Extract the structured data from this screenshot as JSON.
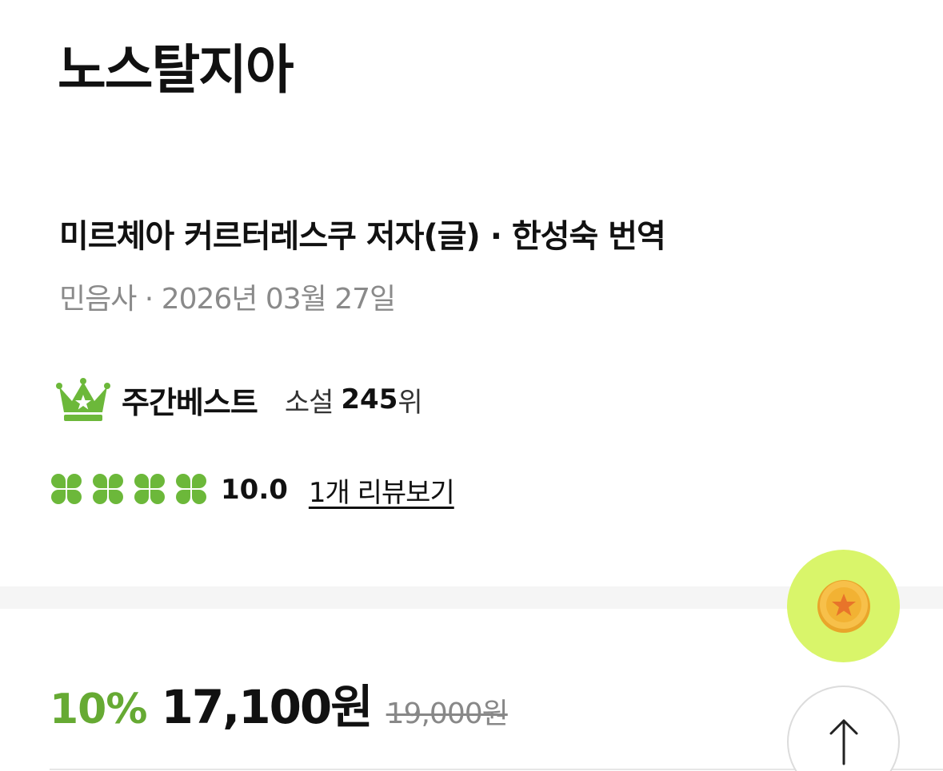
{
  "book": {
    "title": "노스탈지아",
    "authors": "미르체아 커르터레스쿠 저자(글) · 한성숙 번역",
    "publisher_date": "민음사 · 2026년 03월 27일"
  },
  "bestseller": {
    "icon": "crown-icon",
    "label": "주간베스트",
    "category": "소설",
    "rank": "245",
    "rank_unit": "위"
  },
  "rating": {
    "icon": "clover-icon",
    "clover_count": 4,
    "score": "10.0",
    "review_link": "1개 리뷰보기"
  },
  "price": {
    "discount": "10%",
    "sale_price": "17,100원",
    "original_price": "19,000원"
  },
  "fabs": {
    "coin_icon": "star-coin-icon",
    "top_icon": "arrow-up-icon"
  },
  "colors": {
    "accent_green": "#66aa33",
    "clover_green": "#6cb83a",
    "coin_fab_bg": "#d9f56a",
    "coin_gold": "#f2b233",
    "coin_star": "#e8742a"
  }
}
